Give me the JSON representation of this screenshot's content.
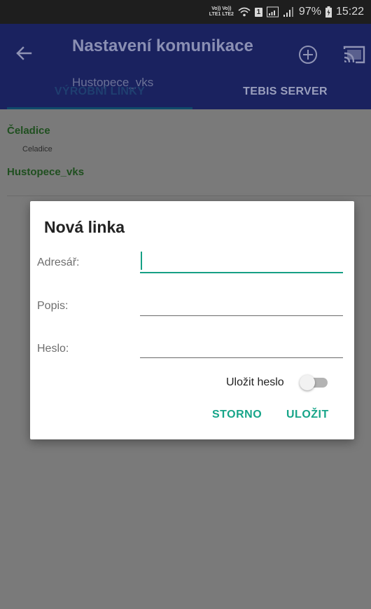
{
  "status_bar": {
    "volte_top": "Vo)) Vo))",
    "volte_bottom": "LTE1 LTE2",
    "sim": "1",
    "battery": "97%",
    "time": "15:22"
  },
  "app_bar": {
    "title": "Nastavení komunikace",
    "subtitle": "Hustopece_vks",
    "tabs": [
      {
        "label": "VÝROBNÍ LINKY",
        "active": true
      },
      {
        "label": "TEBIS SERVER",
        "active": false
      }
    ]
  },
  "list": [
    {
      "name": "Čeladice",
      "description": "Celadice"
    },
    {
      "name": "Hustopece_vks",
      "description": ""
    }
  ],
  "dialog": {
    "title": "Nová linka",
    "fields": [
      {
        "label": "Adresář:",
        "value": ""
      },
      {
        "label": "Popis:",
        "value": ""
      },
      {
        "label": "Heslo:",
        "value": ""
      }
    ],
    "save_password_label": "Uložit heslo",
    "save_password_on": false,
    "cancel_label": "STORNO",
    "save_label": "ULOŽIT"
  },
  "colors": {
    "app_bar": "#1a225f",
    "accent": "#16a085",
    "list_item_name": "#1f4f1f"
  }
}
